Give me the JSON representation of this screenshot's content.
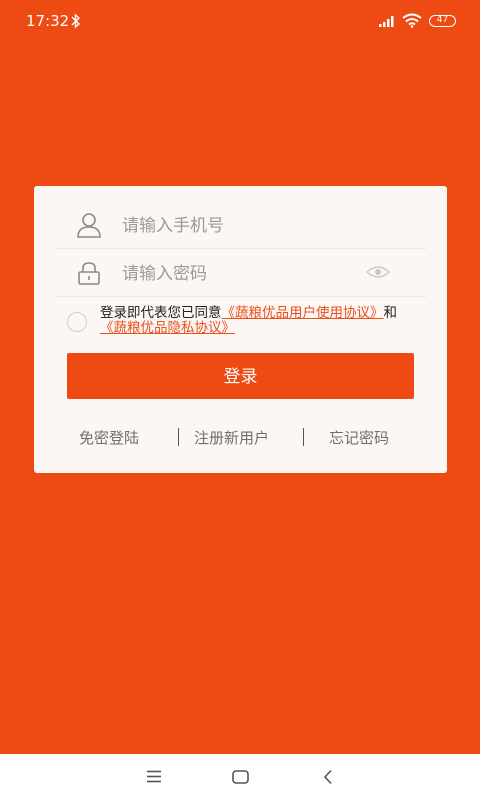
{
  "status_bar": {
    "time": "17:32",
    "battery": "47"
  },
  "login": {
    "phone_placeholder": "请输入手机号",
    "password_placeholder": "请输入密码",
    "agreement_prefix": "登录即代表您已同意",
    "user_agreement_link": "《蔬粮优品用户使用协议》",
    "agreement_conjunction": "和",
    "privacy_link": "《蔬粮优品隐私协议》",
    "login_button": "登录"
  },
  "bottom_links": {
    "passwordless": "免密登陆",
    "register": "注册新用户",
    "forgot": "忘记密码"
  },
  "icons": {
    "phone_field": "user-icon",
    "password_field": "lock-icon",
    "toggle_visibility": "eye-icon",
    "nav": [
      "menu-icon",
      "home-icon",
      "back-icon"
    ]
  },
  "colors": {
    "brand": "#ee4b14",
    "card_bg": "#fcf6f4",
    "link": "#e8501c"
  }
}
